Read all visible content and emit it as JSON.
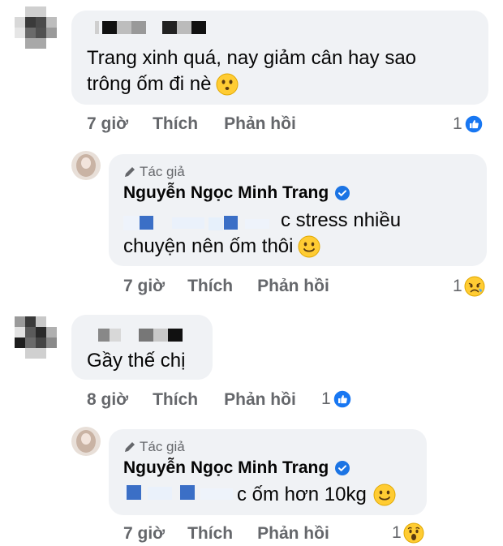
{
  "comments": [
    {
      "text_line1": "Trang xinh quá, nay giảm cân hay sao",
      "text_line2": "trông ốm đi nè",
      "time": "7 giờ",
      "like": "Thích",
      "reply": "Phản hồi",
      "reaction_count": "1",
      "reaction_icon": "like-icon"
    },
    {
      "author_badge": "Tác giả",
      "author_name": "Nguyễn Ngọc Minh Trang",
      "text_line1_visible": "c stress nhiều",
      "text_line2": "chuyện nên ốm thôi",
      "time": "7 giờ",
      "like": "Thích",
      "reply": "Phản hồi",
      "reaction_count": "1",
      "reaction_icon": "sad-icon"
    },
    {
      "text_line1": "Gầy thế chị",
      "time": "8 giờ",
      "like": "Thích",
      "reply": "Phản hồi",
      "reaction_count": "1",
      "reaction_icon": "like-icon"
    },
    {
      "author_badge": "Tác giả",
      "author_name": "Nguyễn Ngọc Minh Trang",
      "text_line1_visible": "c ốm hơn 10kg",
      "time": "7 giờ",
      "like": "Thích",
      "reply": "Phản hồi",
      "reaction_count": "1",
      "reaction_icon": "wow-icon"
    }
  ],
  "colors": {
    "bubble": "#f0f2f5",
    "meta_text": "#65676b",
    "like_blue": "#1877f2",
    "verified_blue": "#1b74e4"
  }
}
